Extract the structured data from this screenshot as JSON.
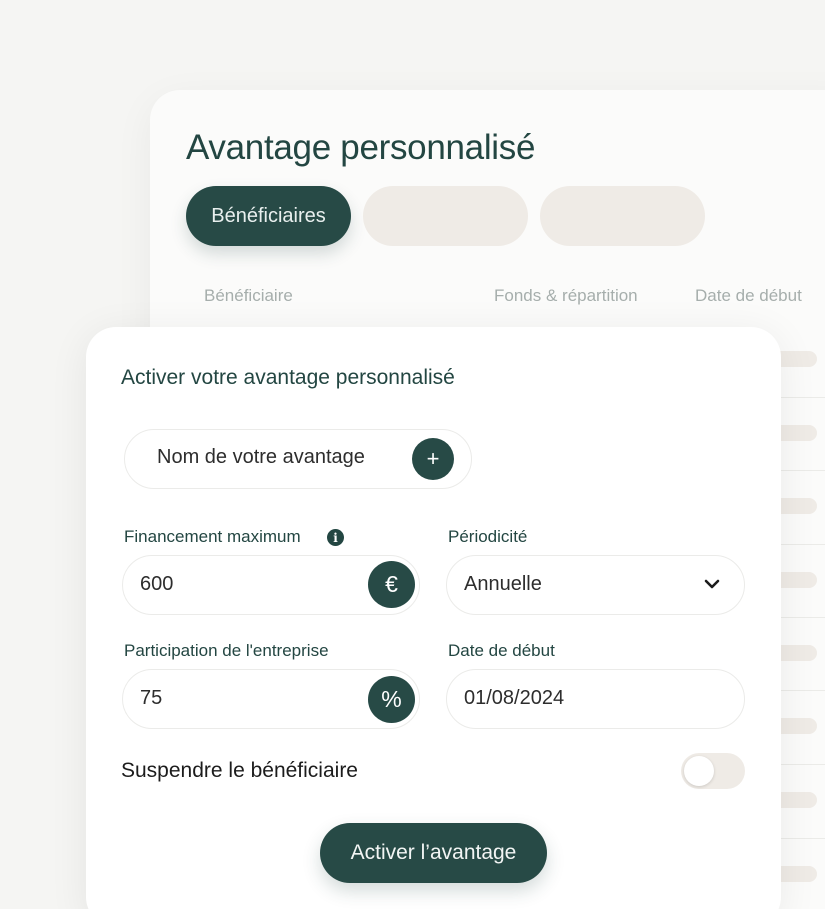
{
  "background_panel": {
    "title": "Avantage personnalisé",
    "tabs": [
      {
        "label": "Bénéficiaires",
        "active": true
      },
      {
        "label": "",
        "active": false
      },
      {
        "label": "",
        "active": false
      }
    ],
    "table_headers": [
      "Bénéficiaire",
      "Fonds & répartition",
      "Date de début"
    ]
  },
  "modal": {
    "title": "Activer votre avantage personnalisé",
    "name_field": {
      "placeholder": "Nom de votre avantage",
      "add_icon": "plus-icon",
      "add_symbol": "+"
    },
    "financement": {
      "label": "Financement maximum",
      "info_icon": "info-icon",
      "info_symbol": "i",
      "value": "600",
      "unit": "€"
    },
    "periodicite": {
      "label": "Périodicité",
      "value": "Annuelle",
      "icon": "chevron-down-icon"
    },
    "participation": {
      "label": "Participation de l'entreprise",
      "value": "75",
      "unit": "%"
    },
    "date_debut": {
      "label": "Date de début",
      "value": "01/08/2024"
    },
    "suspend": {
      "label": "Suspendre le bénéficiaire",
      "checked": false
    },
    "submit_label": "Activer l’avantage"
  },
  "colors": {
    "primary": "#274a46",
    "placeholder_fill": "#efebe6",
    "muted_text": "#a6aeac"
  }
}
